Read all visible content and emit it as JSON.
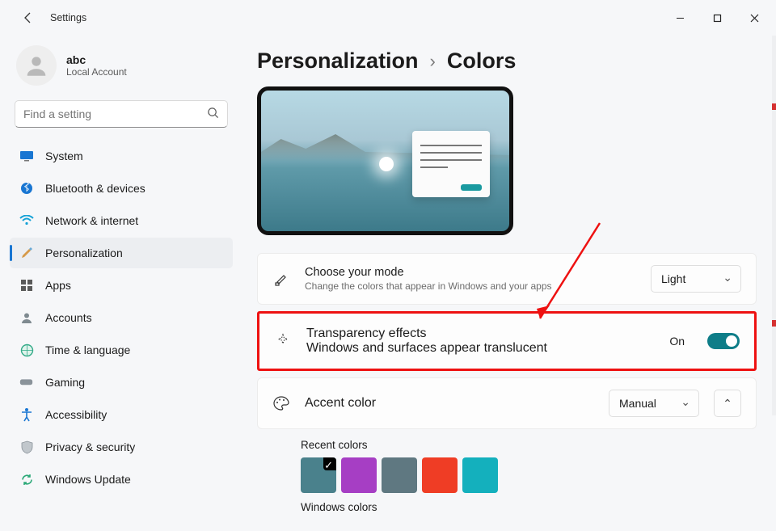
{
  "window": {
    "title": "Settings"
  },
  "user": {
    "name": "abc",
    "subtitle": "Local Account"
  },
  "search": {
    "placeholder": "Find a setting"
  },
  "sidebar": {
    "items": [
      {
        "label": "System"
      },
      {
        "label": "Bluetooth & devices"
      },
      {
        "label": "Network & internet"
      },
      {
        "label": "Personalization"
      },
      {
        "label": "Apps"
      },
      {
        "label": "Accounts"
      },
      {
        "label": "Time & language"
      },
      {
        "label": "Gaming"
      },
      {
        "label": "Accessibility"
      },
      {
        "label": "Privacy & security"
      },
      {
        "label": "Windows Update"
      }
    ],
    "active_index": 3
  },
  "breadcrumb": {
    "parent": "Personalization",
    "current": "Colors"
  },
  "mode_row": {
    "title": "Choose your mode",
    "subtitle": "Change the colors that appear in Windows and your apps",
    "value": "Light"
  },
  "transparency_row": {
    "title": "Transparency effects",
    "subtitle": "Windows and surfaces appear translucent",
    "state_label": "On",
    "enabled": true
  },
  "accent_row": {
    "title": "Accent color",
    "value": "Manual"
  },
  "recent_colors": {
    "heading": "Recent colors",
    "colors": [
      "#4a818c",
      "#a63ec4",
      "#5f7881",
      "#ef3d25",
      "#14b0bd"
    ],
    "selected_index": 0
  },
  "windows_colors": {
    "heading": "Windows colors"
  }
}
